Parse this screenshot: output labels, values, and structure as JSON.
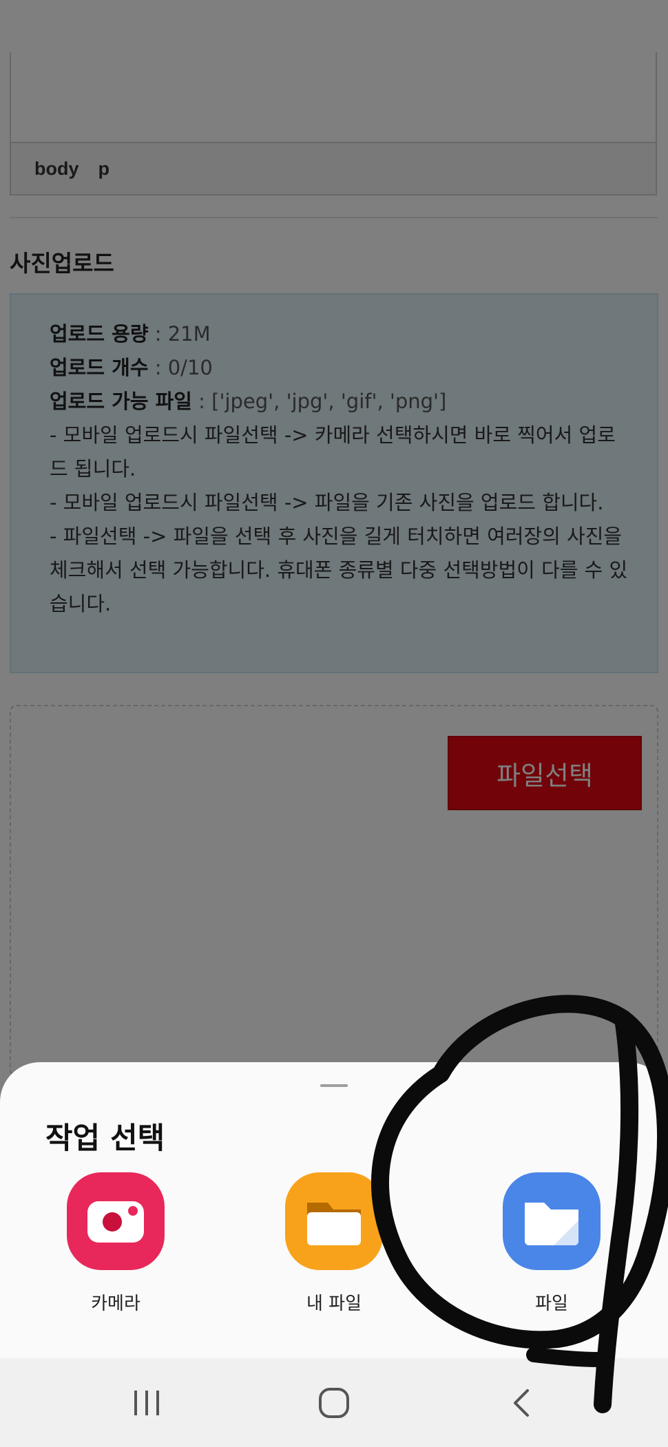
{
  "editor": {
    "status_path": [
      "body",
      "p"
    ]
  },
  "upload_section": {
    "title": "사진업로드",
    "info_rows": [
      {
        "label": "업로드 용량",
        "sep": " : ",
        "value": "21M"
      },
      {
        "label": "업로드 개수",
        "sep": " : ",
        "value": "0/10"
      },
      {
        "label": "업로드 가능 파일",
        "sep": " : ",
        "value": "['jpeg', 'jpg', 'gif', 'png']"
      }
    ],
    "notes": [
      "- 모바일 업로드시 파일선택 -> 카메라 선택하시면 바로 찍어서 업로드 됩니다.",
      "- 모바일 업로드시 파일선택 -> 파일을 기존 사진을 업로드 합니다.",
      "- 파일선택 -> 파일을 선택 후 사진을 길게 터치하면 여러장의 사진을 체크해서 선택 가능합니다. 휴대폰 종류별 다중 선택방법이 다를 수 있습니다."
    ],
    "file_select_button": "파일선택"
  },
  "sheet": {
    "title": "작업 선택",
    "apps": [
      {
        "label": "카메라",
        "icon": "camera-icon",
        "color": "#e8285a"
      },
      {
        "label": "내 파일",
        "icon": "my-files-icon",
        "color": "#f8a21b"
      },
      {
        "label": "파일",
        "icon": "files-icon",
        "color": "#4a86e8"
      }
    ]
  },
  "navbar": {
    "icons": [
      "recents-icon",
      "home-icon",
      "back-icon"
    ]
  },
  "colors": {
    "accent_red": "#e30613",
    "info_bg": "#dff0f6",
    "overlay": "rgba(0,0,0,0.5)"
  }
}
